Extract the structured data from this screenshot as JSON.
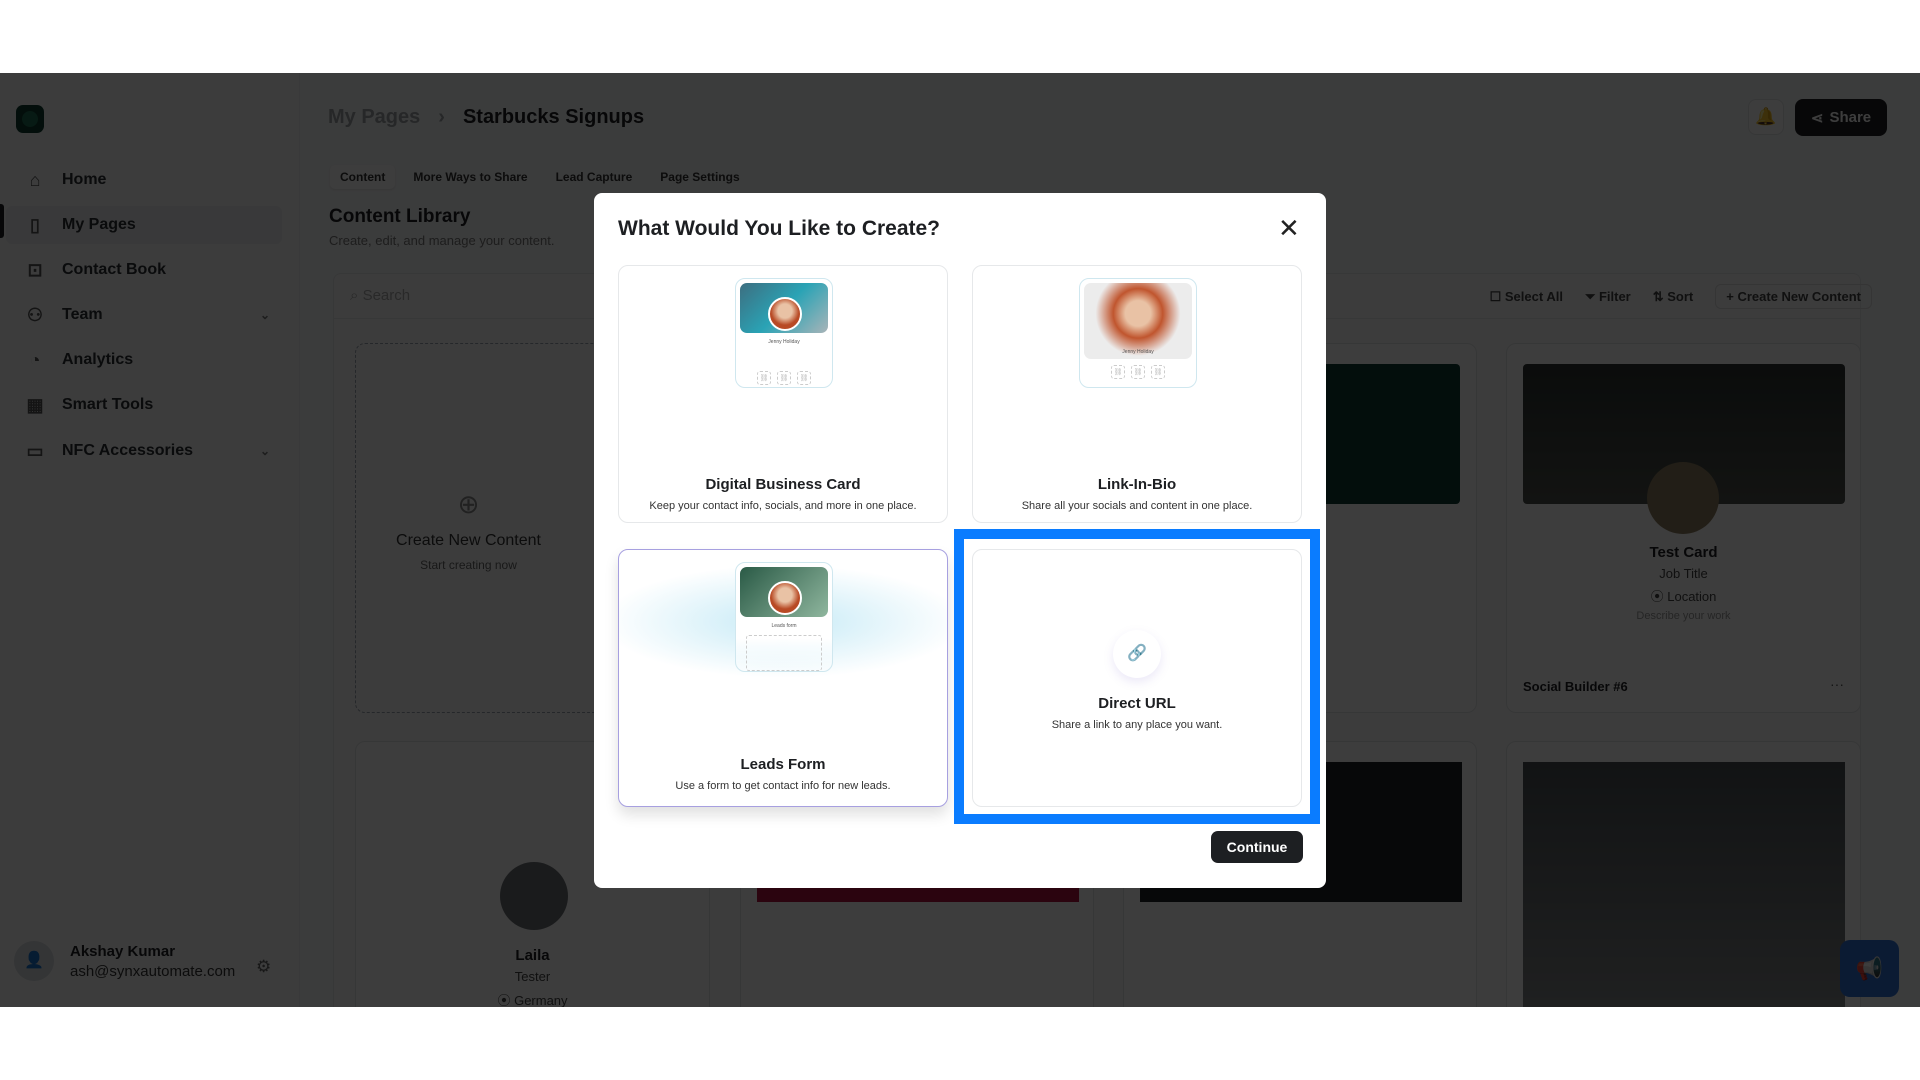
{
  "sidebar": {
    "items": [
      {
        "label": "Home",
        "icon": "home-icon"
      },
      {
        "label": "My Pages",
        "icon": "pages-icon",
        "active": true
      },
      {
        "label": "Contact Book",
        "icon": "contact-book-icon"
      },
      {
        "label": "Team",
        "icon": "team-icon",
        "expandable": true
      },
      {
        "label": "Analytics",
        "icon": "analytics-icon"
      },
      {
        "label": "Smart Tools",
        "icon": "grid-icon"
      },
      {
        "label": "NFC Accessories",
        "icon": "card-icon",
        "expandable": true
      }
    ],
    "user": {
      "name": "Akshay Kumar",
      "email": "ash@synxautomate.com"
    }
  },
  "header": {
    "breadcrumb": [
      "My Pages",
      "Starbucks Signups"
    ],
    "share_label": "Share"
  },
  "tabs": [
    "Content",
    "More Ways to Share",
    "Lead Capture",
    "Page Settings"
  ],
  "library": {
    "title": "Content Library",
    "subtitle": "Create, edit, and manage your content.",
    "search_placeholder": "Search",
    "select_all": "Select All",
    "filter": "Filter",
    "sort": "Sort",
    "create_new": "+ Create New Content",
    "new_card": {
      "title": "Create New Content",
      "subtitle": "Start creating now"
    },
    "test_card": {
      "name": "Test Card",
      "job": "Job Title",
      "location": "Location",
      "description": "Describe your work",
      "label": "Social Builder #6"
    },
    "laila_card": {
      "name": "Laila",
      "job": "Tester",
      "location": "Germany"
    }
  },
  "modal": {
    "title": "What Would You Like to Create?",
    "continue_label": "Continue",
    "options": [
      {
        "title": "Digital Business Card",
        "description": "Keep your contact info, socials, and more in one place.",
        "preview_name": "Jenny Holiday"
      },
      {
        "title": "Link-In-Bio",
        "description": "Share all your socials and content in one place.",
        "preview_name": "Jenny Holiday"
      },
      {
        "title": "Leads Form",
        "description": "Use a form to get contact info for new leads.",
        "preview_name": "Leads form"
      },
      {
        "title": "Direct URL",
        "description": "Share a link to any place you want.",
        "selected": true
      }
    ]
  },
  "colors": {
    "highlight": "#0a7cff",
    "primary_button": "#1d1f22"
  }
}
